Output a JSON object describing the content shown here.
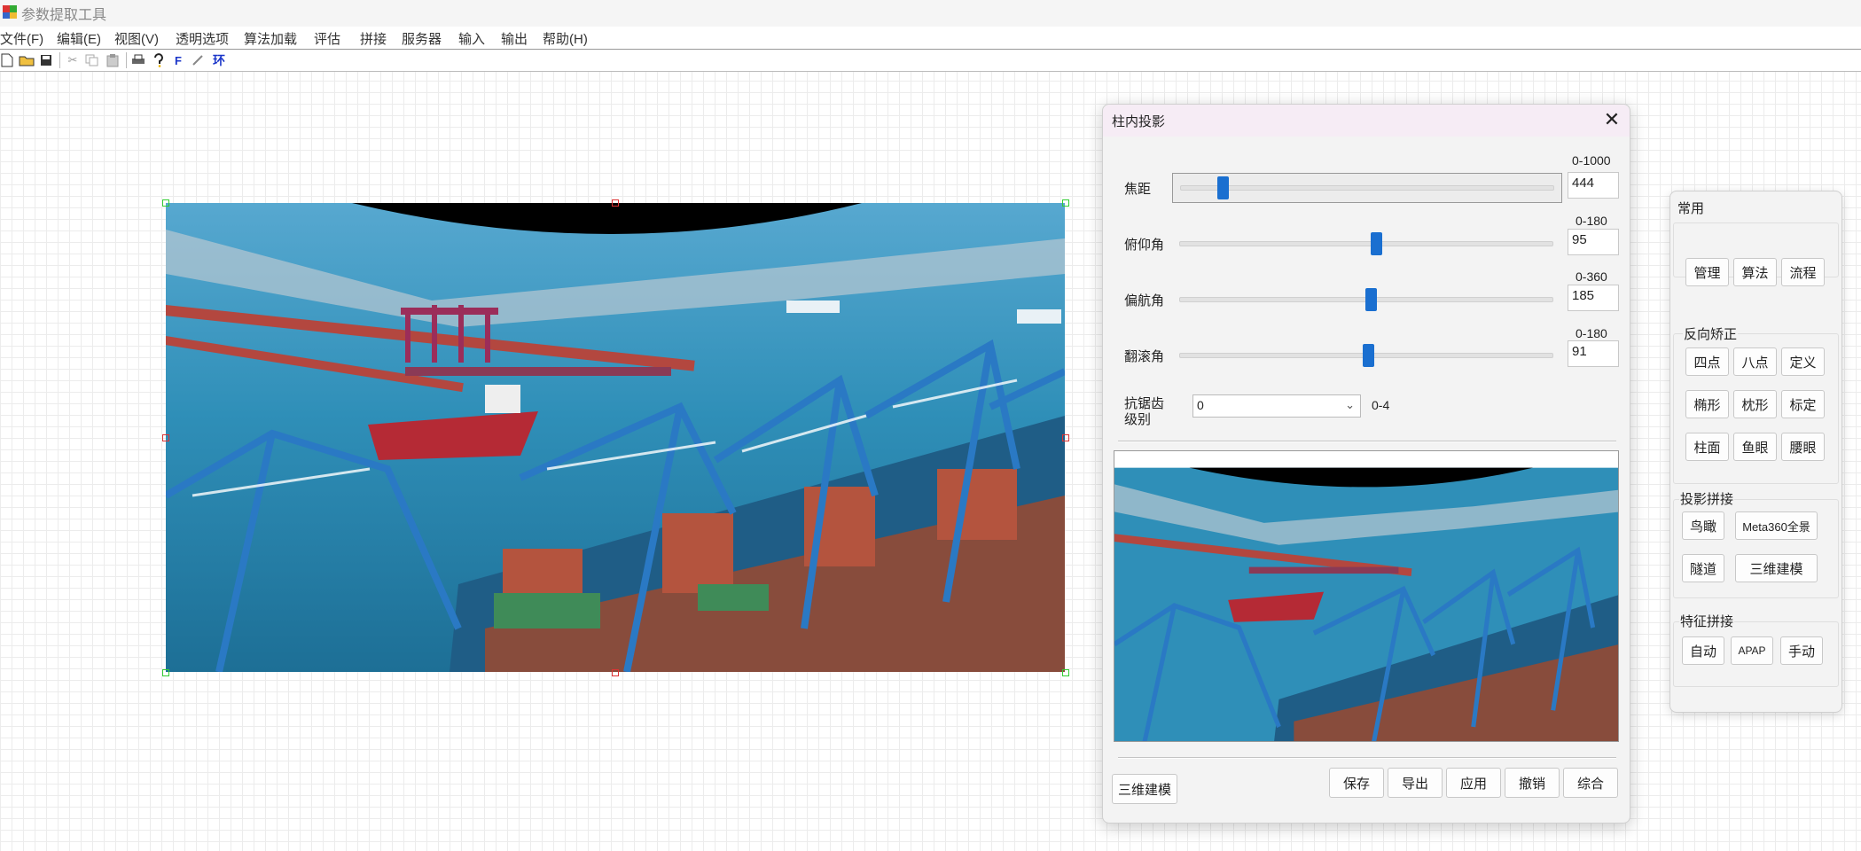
{
  "app": {
    "title": "参数提取工具"
  },
  "menu": [
    {
      "label": "文件(F)"
    },
    {
      "label": "编辑(E)"
    },
    {
      "label": "视图(V)"
    },
    {
      "label": "透明选项"
    },
    {
      "label": "算法加载"
    },
    {
      "label": "评估"
    },
    {
      "label": "拼接"
    },
    {
      "label": "服务器"
    },
    {
      "label": "输入"
    },
    {
      "label": "输出"
    },
    {
      "label": "帮助(H)"
    }
  ],
  "toolbar": {
    "icons": [
      "new-file-icon",
      "open-folder-icon",
      "save-icon",
      "cut-icon",
      "copy-icon",
      "paste-icon",
      "print-icon",
      "help-icon",
      "f-tool-icon",
      "pen-tool-icon",
      "ring-tool-icon"
    ],
    "f_label": "F",
    "ring_label": "环"
  },
  "dialog": {
    "title": "柱内投影",
    "close": "✕",
    "sliders": [
      {
        "label": "焦距",
        "range": "0-1000",
        "value": "444",
        "fraction": 0.115
      },
      {
        "label": "俯仰角",
        "range": "0-180",
        "value": "95",
        "fraction": 0.528
      },
      {
        "label": "偏航角",
        "range": "0-360",
        "value": "185",
        "fraction": 0.514
      },
      {
        "label": "翻滚角",
        "range": "0-180",
        "value": "91",
        "fraction": 0.506
      }
    ],
    "antialias": {
      "label_line1": "抗锯齿",
      "label_line2": "级别",
      "value": "0",
      "range": "0-4"
    },
    "buttons": {
      "model3d": "三维建模",
      "save": "保存",
      "export": "导出",
      "apply": "应用",
      "undo": "撤销",
      "combine": "综合"
    }
  },
  "panel": {
    "title": "常用",
    "common": [
      "管理",
      "算法",
      "流程"
    ],
    "reverse": {
      "title": "反向矫正",
      "items": [
        "四点",
        "八点",
        "定义",
        "椭形",
        "枕形",
        "标定",
        "柱面",
        "鱼眼",
        "腰眼"
      ]
    },
    "projection": {
      "title": "投影拼接",
      "items": [
        "鸟瞰",
        "Meta360全景",
        "隧道",
        "三维建模"
      ]
    },
    "feature": {
      "title": "特征拼接",
      "items": [
        "自动",
        "APAP",
        "手动"
      ]
    }
  }
}
